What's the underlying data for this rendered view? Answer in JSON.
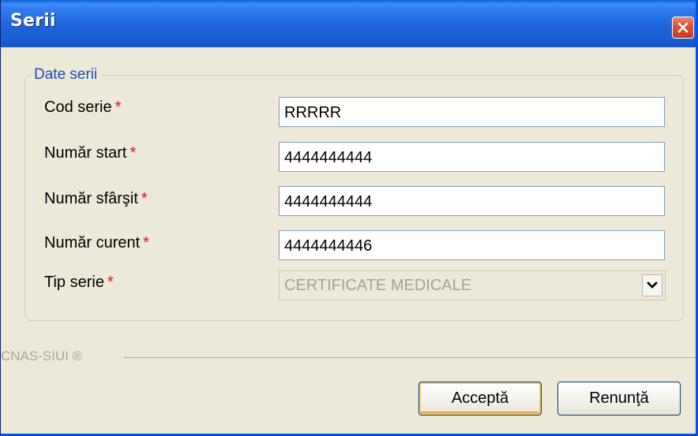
{
  "window": {
    "title": "Serii"
  },
  "group": {
    "legend": "Date serii"
  },
  "fields": {
    "cod_serie": {
      "label": "Cod serie",
      "value": "RRRRR"
    },
    "numar_start": {
      "label": "Număr start",
      "value": "4444444444"
    },
    "numar_sfarsit": {
      "label": "Număr sfârşit",
      "value": "4444444444"
    },
    "numar_curent": {
      "label": "Număr curent",
      "value": "4444444446"
    },
    "tip_serie": {
      "label": "Tip serie",
      "value": "CERTIFICATE MEDICALE"
    }
  },
  "required_marker": "*",
  "footer": {
    "text": "CNAS-SIUI ®"
  },
  "buttons": {
    "accept": "Acceptă",
    "cancel": "Renunţă"
  },
  "colors": {
    "title_bar": "#1e64db",
    "required": "#e01010",
    "legend": "#1f4cb4",
    "close_button": "#d9523a"
  },
  "icons": {
    "close": "close-icon",
    "dropdown": "chevron-down-icon"
  }
}
